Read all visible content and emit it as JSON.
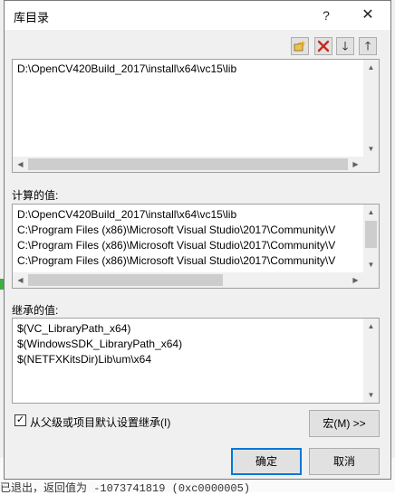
{
  "dialog": {
    "title": "库目录",
    "help_glyph": "?",
    "close_glyph": "✕"
  },
  "toolbar": {
    "new_line_icon": "new-folder-icon",
    "delete_icon": "delete-icon",
    "move_down_glyph": "🡓",
    "move_up_glyph": "🡑"
  },
  "editor": {
    "lines": [
      "D:\\OpenCV420Build_2017\\install\\x64\\vc15\\lib"
    ]
  },
  "computed": {
    "label": "计算的值:",
    "lines": [
      "D:\\OpenCV420Build_2017\\install\\x64\\vc15\\lib",
      "C:\\Program Files (x86)\\Microsoft Visual Studio\\2017\\Community\\V",
      "C:\\Program Files (x86)\\Microsoft Visual Studio\\2017\\Community\\V",
      "C:\\Program Files (x86)\\Microsoft Visual Studio\\2017\\Community\\V"
    ]
  },
  "inherited": {
    "label": "继承的值:",
    "lines": [
      "$(VC_LibraryPath_x64)",
      "$(WindowsSDK_LibraryPath_x64)",
      "$(NETFXKitsDir)Lib\\um\\x64"
    ]
  },
  "inherit_checkbox": {
    "checked": true,
    "glyph": "✓",
    "label": "从父级或项目默认设置继承(I)"
  },
  "buttons": {
    "macros": "宏(M) >>",
    "ok": "确定",
    "cancel": "取消"
  },
  "scroll_arrows": {
    "up": "▲",
    "down": "▼",
    "left": "◀",
    "right": "▶"
  },
  "background": {
    "text": "已退出，返回值为 -1073741819 (0xc0000005)"
  },
  "colors": {
    "accent": "#0078d7",
    "delete_red": "#c42b1c"
  }
}
